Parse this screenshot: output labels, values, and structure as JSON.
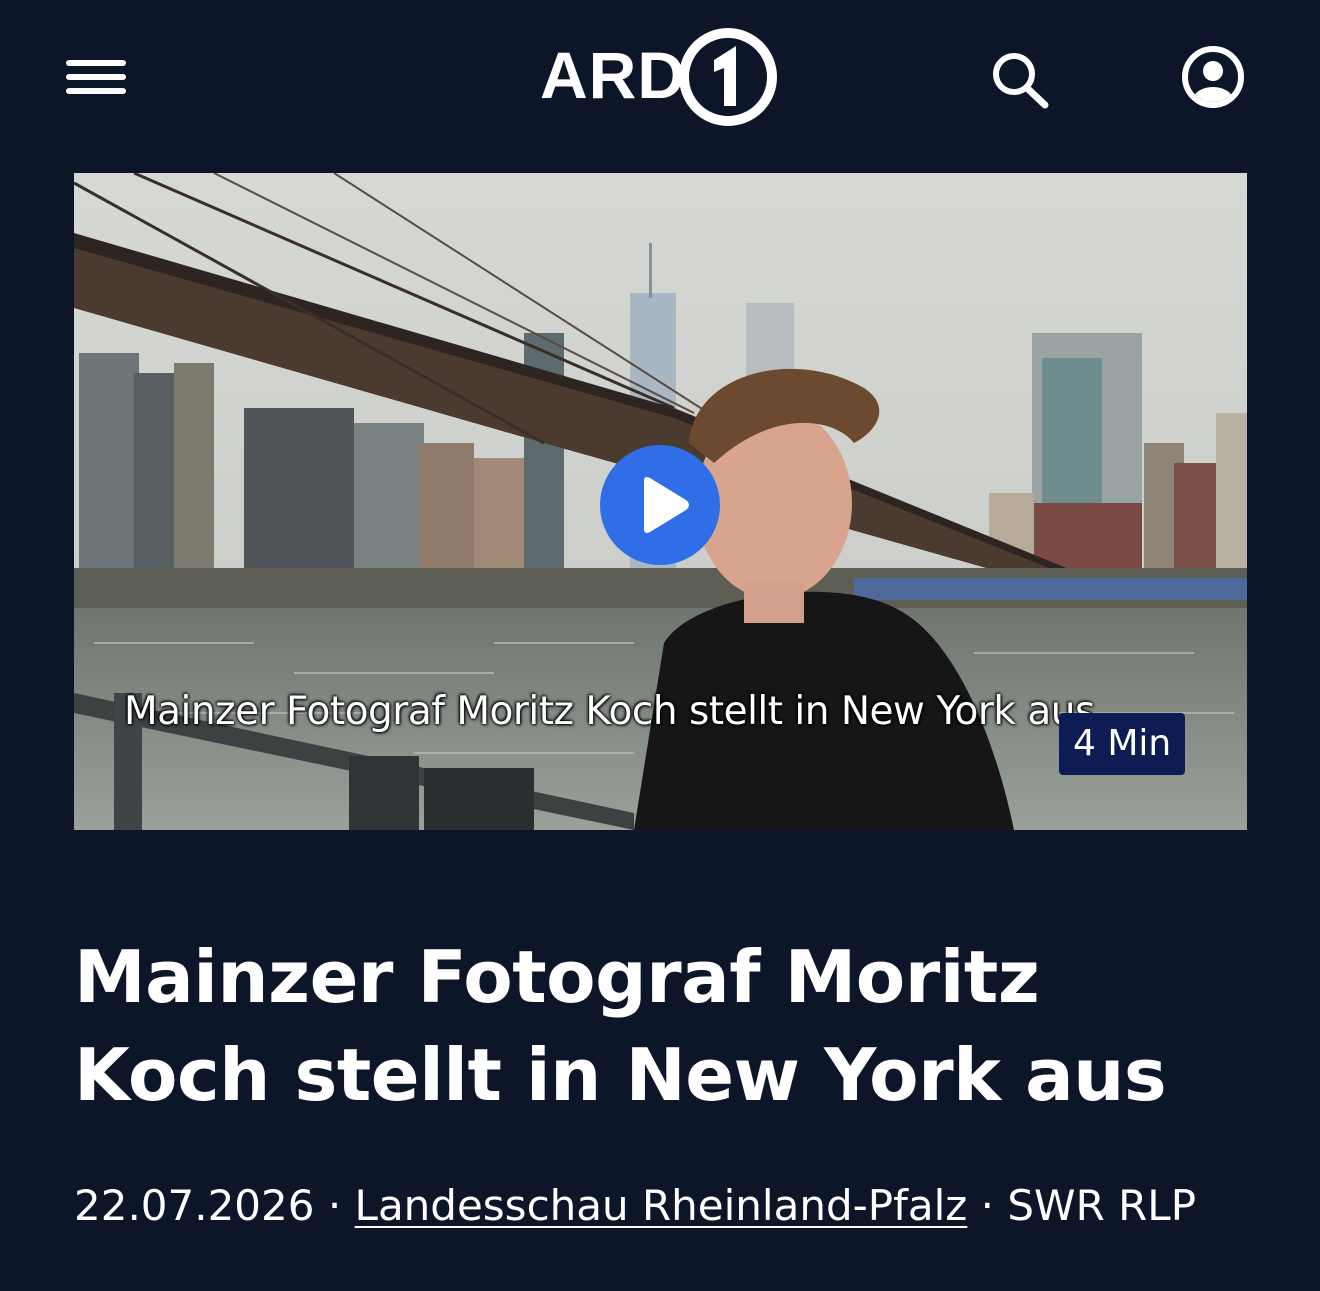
{
  "header": {
    "menu_icon": "hamburger-menu-icon",
    "logo_text": "ARD",
    "logo_icon": "ard-one-logo-icon",
    "search_icon": "search-icon",
    "account_icon": "user-account-icon"
  },
  "video": {
    "caption": "Mainzer Fotograf Moritz Koch stellt in New York aus",
    "duration": "4 Min",
    "play_icon": "play-icon",
    "play_button_color": "#2f6ee6"
  },
  "article": {
    "title": "Mainzer Fotograf Moritz Koch stellt in New York aus",
    "date": "22.07.2026",
    "separator": " · ",
    "show_link": "Landesschau Rheinland-Pfalz",
    "broadcaster": "SWR RLP"
  },
  "colors": {
    "background": "#0d1529",
    "badge": "#0d1d54",
    "accent": "#2f6ee6"
  }
}
